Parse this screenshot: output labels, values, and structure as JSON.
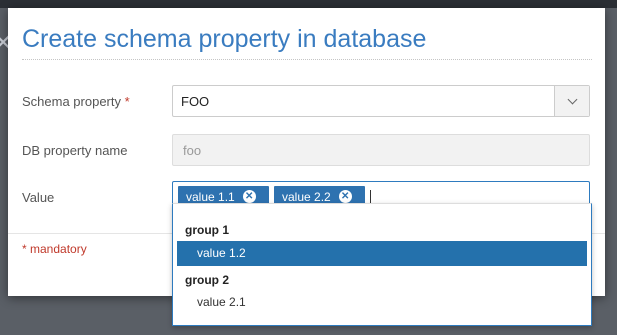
{
  "backdrop": {
    "icon": "close-icon",
    "icon_glyph": "✕"
  },
  "modal": {
    "title": "Create schema property in database"
  },
  "form": {
    "schema_property": {
      "label": "Schema property",
      "required_marker": "*",
      "selected_value": "FOO",
      "dropdown_icon": "chevron-down-icon"
    },
    "db_property_name": {
      "label": "DB property name",
      "value": "foo"
    },
    "value": {
      "label": "Value",
      "tags": [
        {
          "label": "value 1.1",
          "remove_glyph": "✕"
        },
        {
          "label": "value 2.2",
          "remove_glyph": "✕"
        }
      ]
    }
  },
  "footer": {
    "mandatory_marker": "*",
    "mandatory_text": " mandatory"
  },
  "dropdown": {
    "groups": [
      {
        "label": "group 1",
        "options": [
          {
            "label": "value 1.2",
            "selected": true
          }
        ]
      },
      {
        "label": "group 2",
        "options": [
          {
            "label": "value 2.1",
            "selected": false
          }
        ]
      }
    ]
  },
  "colors": {
    "title": "#3a7cc0",
    "accent": "#2e72b0",
    "selected_option": "#2471ac",
    "required": "#c0392b"
  }
}
